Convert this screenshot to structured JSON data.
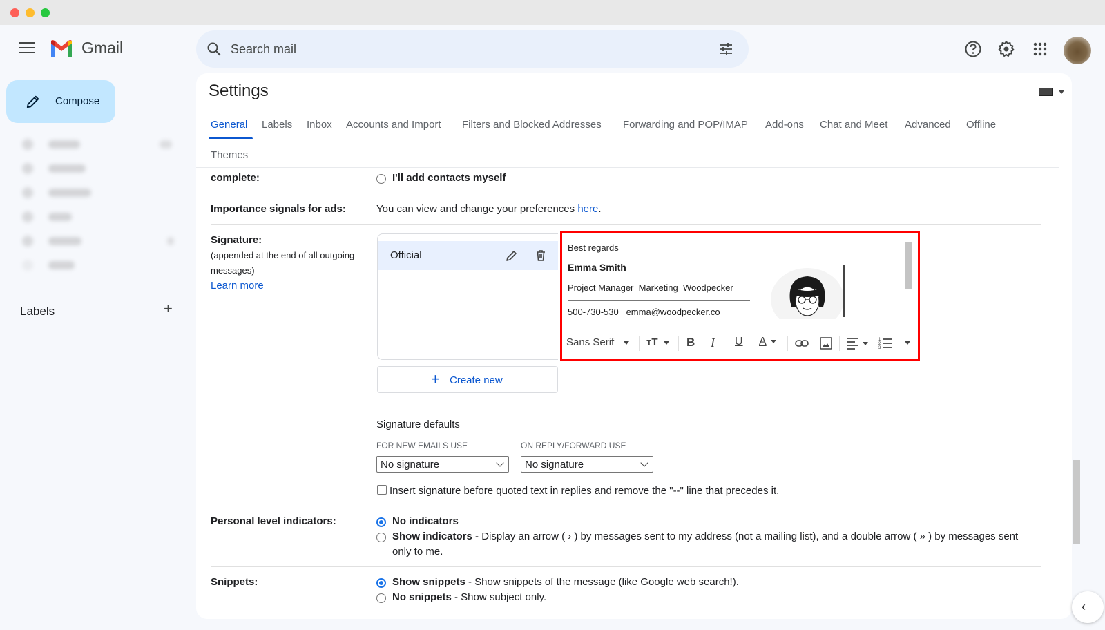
{
  "window": {
    "controls": [
      "close",
      "minimize",
      "maximize"
    ]
  },
  "app": {
    "name": "Gmail"
  },
  "sidebar": {
    "compose_label": "Compose",
    "labels_heading": "Labels",
    "nav_items_blurred": 6
  },
  "search": {
    "placeholder": "Search mail"
  },
  "header_icons": [
    "help-icon",
    "settings-icon",
    "apps-icon",
    "avatar"
  ],
  "settings": {
    "title": "Settings",
    "tabs": [
      {
        "label": "General",
        "active": true
      },
      {
        "label": "Labels"
      },
      {
        "label": "Inbox"
      },
      {
        "label": "Accounts and Import"
      },
      {
        "label": "Filters and Blocked Addresses"
      },
      {
        "label": "Forwarding and POP/IMAP"
      },
      {
        "label": "Add-ons"
      },
      {
        "label": "Chat and Meet"
      },
      {
        "label": "Advanced"
      },
      {
        "label": "Offline"
      },
      {
        "label": "Themes"
      }
    ],
    "autocomplete": {
      "label": "complete:",
      "option": "I'll add contacts myself"
    },
    "importance": {
      "label": "Importance signals for ads:",
      "text": "You can view and change your preferences ",
      "link": "here",
      "after": "."
    },
    "signature": {
      "label": "Signature:",
      "sub1": "(appended at the end of all outgoing",
      "sub2": "messages)",
      "learn_more": "Learn more",
      "list": [
        {
          "name": "Official",
          "selected": true
        }
      ],
      "create_new": "Create new",
      "editor": {
        "line1": "Best regards",
        "name": "Emma Smith",
        "title": "Project Manager",
        "department": "Marketing",
        "company": "Woodpecker",
        "phone": "500-730-530",
        "email": "emma@woodpecker.co"
      },
      "toolbar": {
        "font": "Sans Serif",
        "items": [
          "font-size",
          "bold",
          "italic",
          "underline",
          "text-color",
          "link",
          "image",
          "align",
          "numbered-list",
          "more"
        ]
      },
      "defaults_heading": "Signature defaults",
      "new_emails_label": "FOR NEW EMAILS USE",
      "new_emails_value": "No signature",
      "reply_label": "ON REPLY/FORWARD USE",
      "reply_value": "No signature",
      "insert_before_text": "Insert signature before quoted text in replies and remove the \"--\" line that precedes it.",
      "insert_before_checked": false
    },
    "personal_indicators": {
      "label": "Personal level indicators:",
      "opt1": "No indicators",
      "opt1_selected": true,
      "opt2": "Show indicators",
      "opt2_desc": " - Display an arrow ( › ) by messages sent to my address (not a mailing list), and a double arrow ( » ) by messages sent",
      "opt2_desc2": "only to me."
    },
    "snippets": {
      "label": "Snippets:",
      "opt1": "Show snippets",
      "opt1_desc": " - Show snippets of the message (like Google web search!).",
      "opt1_selected": true,
      "opt2": "No snippets",
      "opt2_desc": " - Show subject only."
    }
  }
}
